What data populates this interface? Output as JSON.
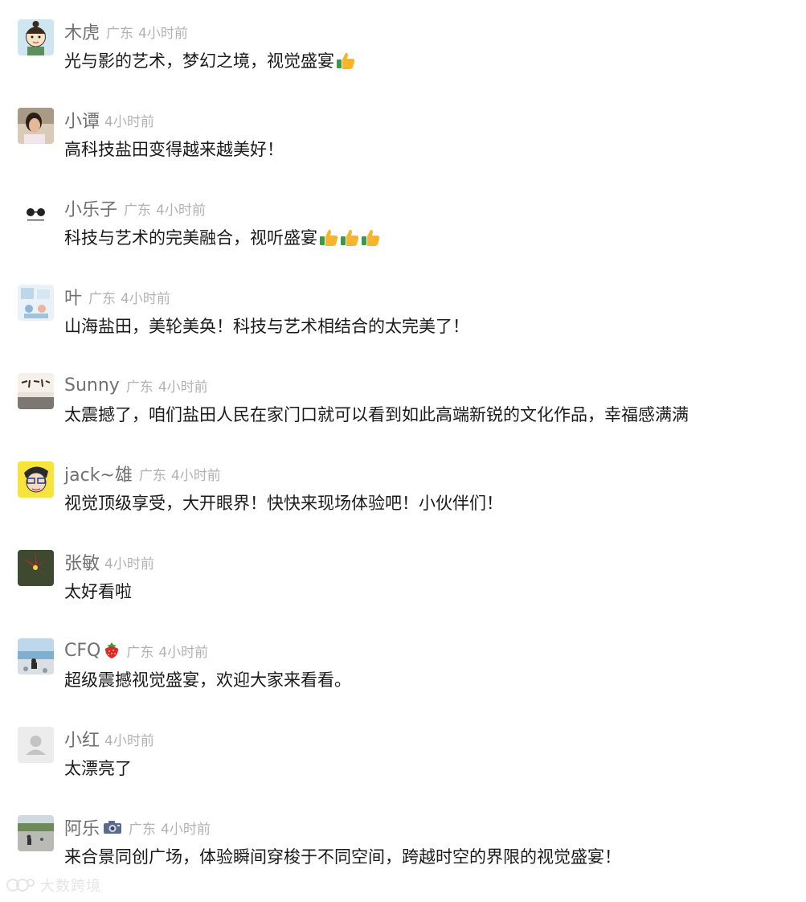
{
  "comments": [
    {
      "name": "木虎",
      "location": "广东",
      "time": "4小时前",
      "text": "光与影的艺术，梦幻之境，视觉盛宴",
      "emoji": "thumbs-up-icon",
      "emoji_count": 1,
      "avatar": "cartoon-girl-avatar-icon"
    },
    {
      "name": "小谭",
      "location": "",
      "time": "4小时前",
      "text": "高科技盐田变得越来越美好！",
      "emoji": "",
      "emoji_count": 0,
      "avatar": "girl-photo-avatar-icon"
    },
    {
      "name": "小乐子",
      "location": "广东",
      "time": "4小时前",
      "text": "科技与艺术的完美融合，视听盛宴",
      "emoji": "thumbs-up-icon",
      "emoji_count": 3,
      "avatar": "sunglasses-avatar-icon"
    },
    {
      "name": "叶",
      "location": "广东",
      "time": "4小时前",
      "text": "山海盐田，美轮美奂！科技与艺术相结合的太完美了！",
      "emoji": "",
      "emoji_count": 0,
      "avatar": "illustration-avatar-icon"
    },
    {
      "name": "Sunny",
      "location": "广东",
      "time": "4小时前",
      "text": "太震撼了，咱们盐田人民在家门口就可以看到如此高端新锐的文化作品，幸福感满满",
      "emoji": "",
      "emoji_count": 0,
      "avatar": "calligraphy-avatar-icon"
    },
    {
      "name": "jack~雄",
      "location": "广东",
      "time": "4小时前",
      "text": "视觉顶级享受，大开眼界！快快来现场体验吧！小伙伴们！",
      "emoji": "",
      "emoji_count": 0,
      "avatar": "cartoon-man-avatar-icon"
    },
    {
      "name": "张敏",
      "location": "",
      "time": "4小时前",
      "text": "太好看啦",
      "emoji": "",
      "emoji_count": 0,
      "avatar": "red-flower-avatar-icon"
    },
    {
      "name": "CFQ",
      "name_icon": "strawberry-icon",
      "location": "广东",
      "time": "4小时前",
      "text": "超级震撼视觉盛宴，欢迎大家来看看。",
      "emoji": "",
      "emoji_count": 0,
      "avatar": "seaside-avatar-icon"
    },
    {
      "name": "小红",
      "location": "",
      "time": "4小时前",
      "text": "太漂亮了",
      "emoji": "",
      "emoji_count": 0,
      "avatar": "default-user-avatar-icon"
    },
    {
      "name": "阿乐",
      "name_icon": "camera-icon",
      "location": "广东",
      "time": "4小时前",
      "text": "来合景同创广场，体验瞬间穿梭于不同空间，跨越时空的界限的视觉盛宴！",
      "emoji": "",
      "emoji_count": 0,
      "avatar": "landscape-avatar-icon"
    }
  ],
  "watermark": {
    "text": "大数跨境",
    "icon": "watermark-logo-icon"
  },
  "colors": {
    "name": "#707070",
    "meta": "#b2b2b2",
    "text": "#1a1a1a",
    "background": "#ffffff"
  }
}
